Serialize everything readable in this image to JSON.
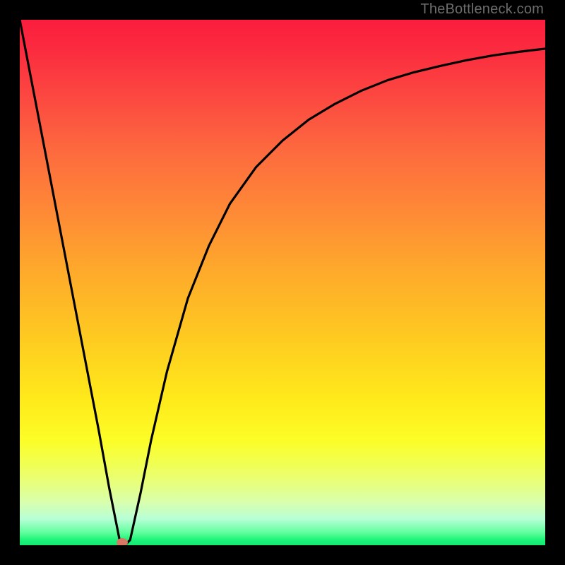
{
  "watermark": "TheBottleneck.com",
  "dot": {
    "x_pct": 19.5,
    "y_pct": 99.5
  },
  "chart_data": {
    "type": "line",
    "title": "",
    "xlabel": "",
    "ylabel": "",
    "xlim": [
      0,
      100
    ],
    "ylim": [
      0,
      100
    ],
    "grid": false,
    "series": [
      {
        "name": "bottleneck-curve",
        "x": [
          0,
          5,
          10,
          15,
          17,
          19,
          20,
          21,
          23,
          25,
          28,
          32,
          36,
          40,
          45,
          50,
          55,
          60,
          65,
          70,
          75,
          80,
          85,
          90,
          95,
          100
        ],
        "values": [
          100,
          74,
          48,
          22,
          11,
          1,
          0,
          1,
          10,
          20,
          33,
          47,
          57,
          65,
          72,
          77,
          81,
          84,
          86.5,
          88.5,
          90,
          91.2,
          92.3,
          93.2,
          93.9,
          94.5
        ]
      }
    ],
    "marker": {
      "x": 19.5,
      "y": 0.5,
      "color": "#d87763"
    },
    "background_gradient": {
      "from": "#fb1d3e",
      "to": "#15e873",
      "stops": [
        "#fb1d3e",
        "#fd6a3e",
        "#fec921",
        "#ffe91b",
        "#b7ffd6",
        "#15e873"
      ]
    }
  }
}
